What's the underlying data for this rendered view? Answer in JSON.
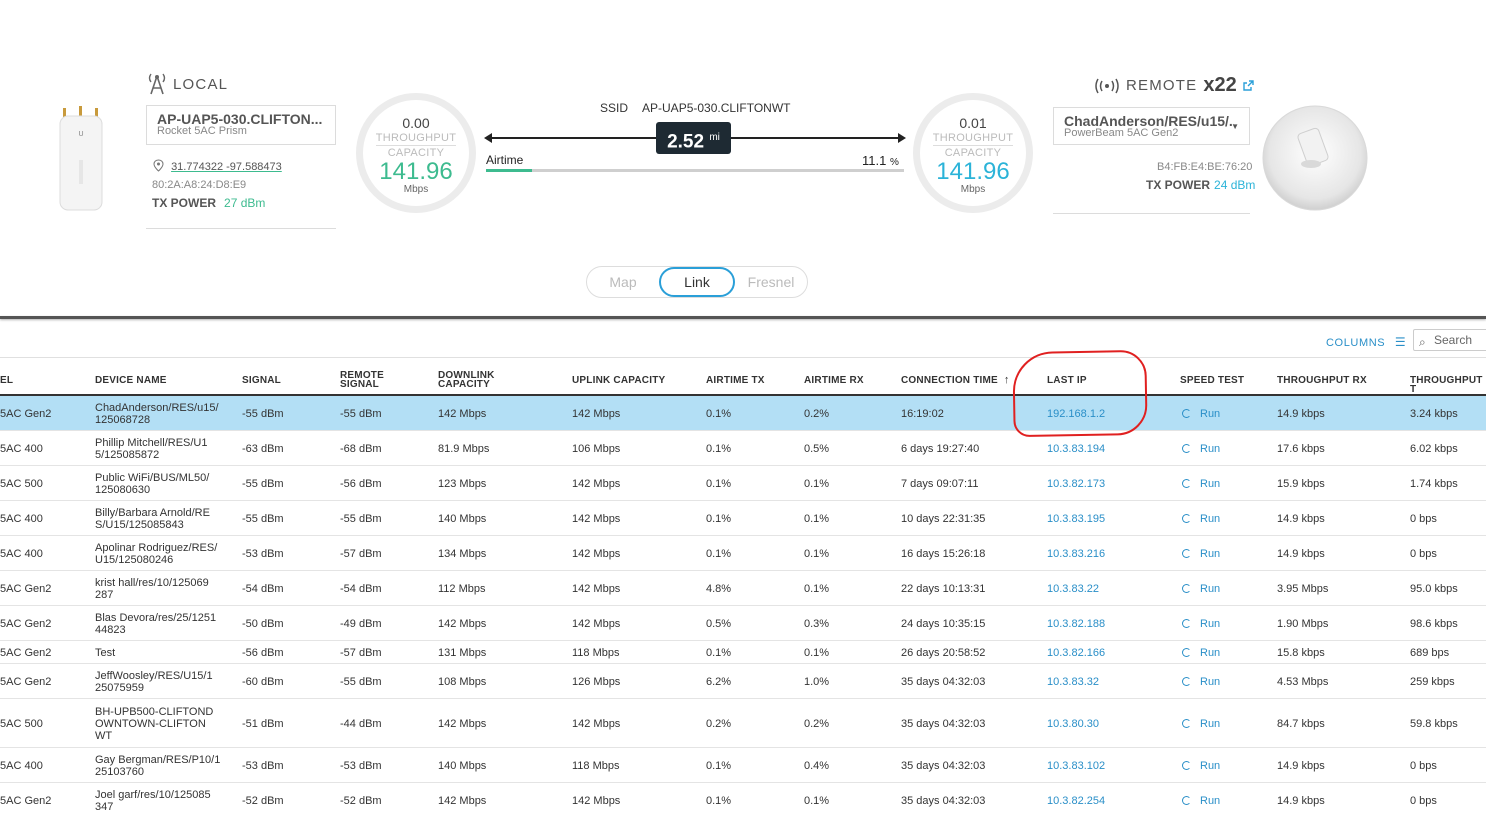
{
  "local": {
    "title": "LOCAL",
    "device_name": "AP-UAP5-030.CLIFTON...",
    "model": "Rocket 5AC Prism",
    "coords": "31.774322 -97.588473",
    "mac": "80:2A:A8:24:D8:E9",
    "tx_power_label": "TX POWER",
    "tx_power_value": "27 dBm",
    "gauge": {
      "throughput": "0.00",
      "throughput_label": "THROUGHPUT",
      "capacity_label": "CAPACITY",
      "capacity": "141.96",
      "unit": "Mbps",
      "color": "#3dbb8f"
    }
  },
  "remote": {
    "title": "REMOTE",
    "count": "x22",
    "device_name": "ChadAnderson/RES/u15/...",
    "model": "PowerBeam 5AC Gen2",
    "mac": "B4:FB:E4:BE:76:20",
    "tx_power_label": "TX POWER",
    "tx_power_value": "24 dBm",
    "gauge": {
      "throughput": "0.01",
      "throughput_label": "THROUGHPUT",
      "capacity_label": "CAPACITY",
      "capacity": "141.96",
      "unit": "Mbps",
      "color": "#2bb3d8"
    }
  },
  "link": {
    "ssid_label": "SSID",
    "ssid": "AP-UAP5-030.CLIFTONWT",
    "distance": "2.52",
    "distance_unit": "mi",
    "airtime_label": "Airtime",
    "airtime_value": "11.1",
    "airtime_unit": "%",
    "airtime_fraction": 0.111
  },
  "tabs": [
    "Map",
    "Link",
    "Fresnel"
  ],
  "active_tab": "Link",
  "toolbar": {
    "columns_label": "COLUMNS",
    "search_placeholder": "Search"
  },
  "table": {
    "headers": [
      "EL",
      "DEVICE NAME",
      "SIGNAL",
      "REMOTE SIGNAL",
      "DOWNLINK CAPACITY",
      "UPLINK CAPACITY",
      "AIRTIME TX",
      "AIRTIME RX",
      "CONNECTION TIME",
      "LAST IP",
      "SPEED TEST",
      "THROUGHPUT RX",
      "THROUGHPUT T"
    ],
    "run_label": "Run",
    "rows": [
      [
        "5AC Gen2",
        "ChadAnderson/RES/u15/\n125068728",
        "-55 dBm",
        "-55 dBm",
        "142 Mbps",
        "142 Mbps",
        "0.1%",
        "0.2%",
        "16:19:02",
        "192.168.1.2",
        "14.9 kbps",
        "3.24 kbps"
      ],
      [
        "5AC 400",
        "Phillip Mitchell/RES/U1\n5/125085872",
        "-63 dBm",
        "-68 dBm",
        "81.9 Mbps",
        "106 Mbps",
        "0.1%",
        "0.5%",
        "6 days 19:27:40",
        "10.3.83.194",
        "17.6 kbps",
        "6.02 kbps"
      ],
      [
        "5AC 500",
        "Public WiFi/BUS/ML50/\n125080630",
        "-55 dBm",
        "-56 dBm",
        "123 Mbps",
        "142 Mbps",
        "0.1%",
        "0.1%",
        "7 days 09:07:11",
        "10.3.82.173",
        "15.9 kbps",
        "1.74 kbps"
      ],
      [
        "5AC 400",
        "Billy/Barbara Arnold/RE\nS/U15/125085843",
        "-55 dBm",
        "-55 dBm",
        "140 Mbps",
        "142 Mbps",
        "0.1%",
        "0.1%",
        "10 days 22:31:35",
        "10.3.83.195",
        "14.9 kbps",
        "0 bps"
      ],
      [
        "5AC 400",
        "Apolinar Rodriguez/RES/\nU15/125080246",
        "-53 dBm",
        "-57 dBm",
        "134 Mbps",
        "142 Mbps",
        "0.1%",
        "0.1%",
        "16 days 15:26:18",
        "10.3.83.216",
        "14.9 kbps",
        "0 bps"
      ],
      [
        "5AC Gen2",
        "krist hall/res/10/125069\n287",
        "-54 dBm",
        "-54 dBm",
        "112 Mbps",
        "142 Mbps",
        "4.8%",
        "0.1%",
        "22 days 10:13:31",
        "10.3.83.22",
        "3.95 Mbps",
        "95.0 kbps"
      ],
      [
        "5AC Gen2",
        "Blas Devora/res/25/1251\n44823",
        "-50 dBm",
        "-49 dBm",
        "142 Mbps",
        "142 Mbps",
        "0.5%",
        "0.3%",
        "24 days 10:35:15",
        "10.3.82.188",
        "1.90 Mbps",
        "98.6 kbps"
      ],
      [
        "5AC Gen2",
        "Test",
        "-56 dBm",
        "-57 dBm",
        "131 Mbps",
        "118 Mbps",
        "0.1%",
        "0.1%",
        "26 days 20:58:52",
        "10.3.82.166",
        "15.8 kbps",
        "689 bps"
      ],
      [
        "5AC Gen2",
        "JeffWoosley/RES/U15/1\n25075959",
        "-60 dBm",
        "-55 dBm",
        "108 Mbps",
        "126 Mbps",
        "6.2%",
        "1.0%",
        "35 days 04:32:03",
        "10.3.83.32",
        "4.53 Mbps",
        "259 kbps"
      ],
      [
        "5AC 500",
        "BH-UPB500-CLIFTOND\nOWNTOWN-CLIFTON\nWT",
        "-51 dBm",
        "-44 dBm",
        "142 Mbps",
        "142 Mbps",
        "0.2%",
        "0.2%",
        "35 days 04:32:03",
        "10.3.80.30",
        "84.7 kbps",
        "59.8 kbps"
      ],
      [
        "5AC 400",
        "Gay Bergman/RES/P10/1\n25103760",
        "-53 dBm",
        "-53 dBm",
        "140 Mbps",
        "118 Mbps",
        "0.1%",
        "0.4%",
        "35 days 04:32:03",
        "10.3.83.102",
        "14.9 kbps",
        "0 bps"
      ],
      [
        "5AC Gen2",
        "Joel garf/res/10/125085\n347",
        "-52 dBm",
        "-52 dBm",
        "142 Mbps",
        "142 Mbps",
        "0.1%",
        "0.1%",
        "35 days 04:32:03",
        "10.3.82.254",
        "14.9 kbps",
        "0 bps"
      ]
    ]
  }
}
